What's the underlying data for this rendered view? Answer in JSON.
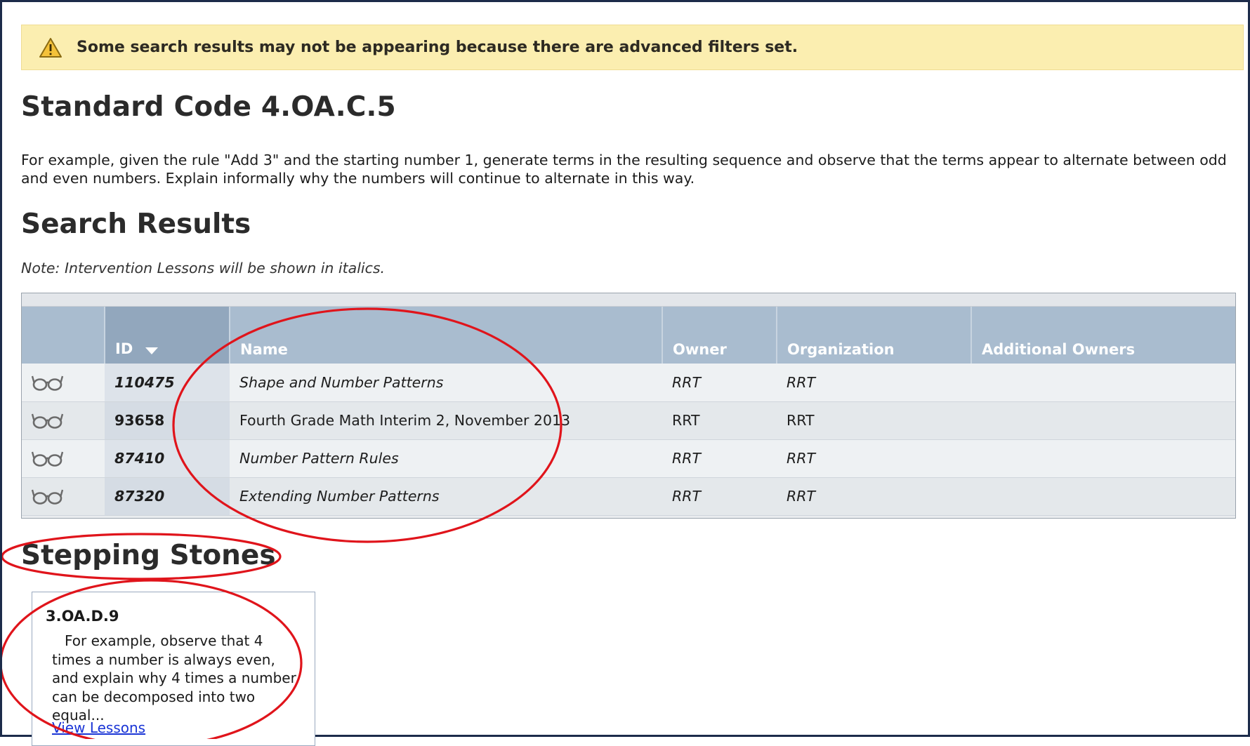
{
  "alert": {
    "icon": "warning-triangle-icon",
    "text": "Some search results may not be appearing because there are advanced filters set."
  },
  "standard": {
    "title": "Standard Code 4.OA.C.5",
    "description": "For example, given the rule \"Add 3\" and the starting number 1, generate terms in the resulting sequence and observe that the terms appear to alternate between odd and even numbers. Explain informally why the numbers will continue to alternate in this way."
  },
  "search": {
    "title": "Search Results",
    "note": "Note: Intervention Lessons will be shown in italics.",
    "columns": [
      "",
      "ID",
      "Name",
      "Owner",
      "Organization",
      "Additional Owners"
    ],
    "sort_icon": "sort-descending-icon",
    "row_icon": "eyeglasses-icon",
    "rows": [
      {
        "id": "110475",
        "name": "Shape and Number Patterns",
        "owner": "RRT",
        "organization": "RRT",
        "additional_owners": "",
        "intervention": true
      },
      {
        "id": "93658",
        "name": "Fourth Grade Math Interim 2, November 2013",
        "owner": "RRT",
        "organization": "RRT",
        "additional_owners": "",
        "intervention": false
      },
      {
        "id": "87410",
        "name": "Number Pattern Rules",
        "owner": "RRT",
        "organization": "RRT",
        "additional_owners": "",
        "intervention": true
      },
      {
        "id": "87320",
        "name": "Extending Number Patterns",
        "owner": "RRT",
        "organization": "RRT",
        "additional_owners": "",
        "intervention": true
      }
    ]
  },
  "stepping_stones": {
    "title": "Stepping Stones",
    "cards": [
      {
        "code": "3.OA.D.9",
        "description": "For example, observe that 4 times a number is always even, and explain why 4 times a number can be decomposed into two equal...",
        "link": "View Lessons"
      }
    ]
  },
  "colors": {
    "annotation": "#e0141b",
    "header_bg": "#a9bccf",
    "alert_bg": "#fbeeb0",
    "link": "#1a35d6"
  }
}
